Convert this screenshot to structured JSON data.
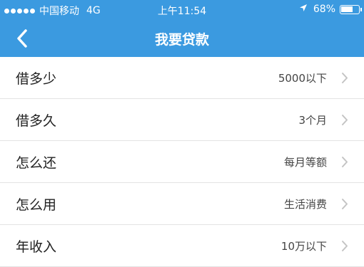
{
  "status_bar": {
    "carrier": "中国移动",
    "network": "4G",
    "time": "上午11:54",
    "battery_text": "68%",
    "battery_level": 0.68
  },
  "nav": {
    "back_icon": "chevron-left-icon",
    "title": "我要贷款"
  },
  "rows": [
    {
      "label": "借多少",
      "value": "5000以下"
    },
    {
      "label": "借多久",
      "value": "3个月"
    },
    {
      "label": "怎么还",
      "value": "每月等额"
    },
    {
      "label": "怎么用",
      "value": "生活消费"
    },
    {
      "label": "年收入",
      "value": "10万以下"
    }
  ],
  "colors": {
    "header": "#3b9ae0",
    "background": "#f2f2f2",
    "chevron": "#c4c4c4"
  }
}
